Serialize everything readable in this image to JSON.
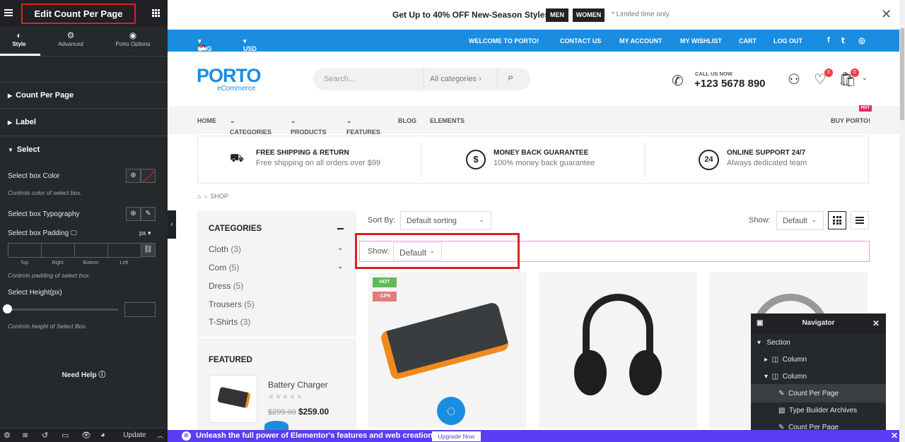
{
  "panel": {
    "title": "Edit Count Per Page",
    "tabs": [
      {
        "label": "Style",
        "icon": "half-circle-icon"
      },
      {
        "label": "Advanced",
        "icon": "gear-icon"
      },
      {
        "label": "Porto Options",
        "icon": "target-icon"
      }
    ],
    "sections": {
      "count_per_page": "Count Per Page",
      "label": "Label",
      "select": "Select"
    },
    "controls": {
      "box_color": "Select box Color",
      "box_color_hint": "Controls color of select box.",
      "typography": "Select box Typography",
      "padding": "Select box Padding",
      "padding_unit": "px",
      "dims": [
        "Top",
        "Right",
        "Bottom",
        "Left"
      ],
      "padding_hint": "Controls padding of select box.",
      "height": "Select Height(px)",
      "height_value": 0,
      "height_hint": "Controls height of Select Box."
    },
    "need_help": "Need Help",
    "update": "Update"
  },
  "topbar": {
    "promo_pre": "Get Up to ",
    "promo_bold": "40% OFF",
    "promo_post": " New-Season Styles",
    "men": "MEN",
    "women": "WOMEN",
    "limited": "* Limited time only."
  },
  "bluebar": {
    "lang": "ENG",
    "currency": "USD",
    "links": [
      "WELCOME TO PORTO!",
      "CONTACT US",
      "MY ACCOUNT",
      "MY WISHLIST",
      "CART",
      "LOG OUT"
    ],
    "social": [
      "f",
      "t",
      "ig"
    ]
  },
  "header": {
    "logo": "PORTO",
    "logo_sub": "eCommerce",
    "search_placeholder": "Search...",
    "categories": "All categories",
    "call_label": "CALL US NOW",
    "phone": "+123 5678 890",
    "wishlist_count": "0",
    "cart_count": "0"
  },
  "nav": {
    "items": [
      "HOME",
      "CATEGORIES",
      "PRODUCTS",
      "FEATURES",
      "BLOG",
      "ELEMENTS"
    ],
    "buy": "BUY PORTO!",
    "hot": "HOT"
  },
  "info": [
    {
      "title": "FREE SHIPPING & RETURN",
      "sub": "Free shipping on all orders over $99"
    },
    {
      "title": "MONEY BACK GUARANTEE",
      "sub": "100% money back guarantee"
    },
    {
      "title": "ONLINE SUPPORT 24/7",
      "sub": "Always dedicated team"
    }
  ],
  "breadcrumb": "SHOP",
  "sidebar": {
    "categories_title": "CATEGORIES",
    "categories": [
      {
        "name": "Cloth",
        "count": "(3)"
      },
      {
        "name": "Com",
        "count": "(5)"
      },
      {
        "name": "Dress",
        "count": "(5)"
      },
      {
        "name": "Trousers",
        "count": "(5)"
      },
      {
        "name": "T-Shirts",
        "count": "(3)"
      }
    ],
    "featured_title": "FEATURED",
    "featured_name": "Battery Charger",
    "featured_old": "$299.00",
    "featured_price": "$259.00"
  },
  "toolbar": {
    "sort_label": "Sort By:",
    "sort_value": "Default sorting",
    "show_label": "Show:",
    "show_value": "Default"
  },
  "showbox": {
    "label": "Show:",
    "value": "Default"
  },
  "products": {
    "hot": "HOT",
    "discount": "-13%"
  },
  "navigator": {
    "title": "Navigator",
    "items": [
      "Section",
      "Column",
      "Column",
      "Count Per Page",
      "Type Builder Archives",
      "Count Per Page"
    ]
  },
  "banner": {
    "text": "Unleash the full power of Elementor's features and web creation tools.",
    "button": "Upgrade Now"
  },
  "colors": {
    "accent": "#1a8de1",
    "highlight": "#e02020",
    "banner": "#5a3df2"
  }
}
